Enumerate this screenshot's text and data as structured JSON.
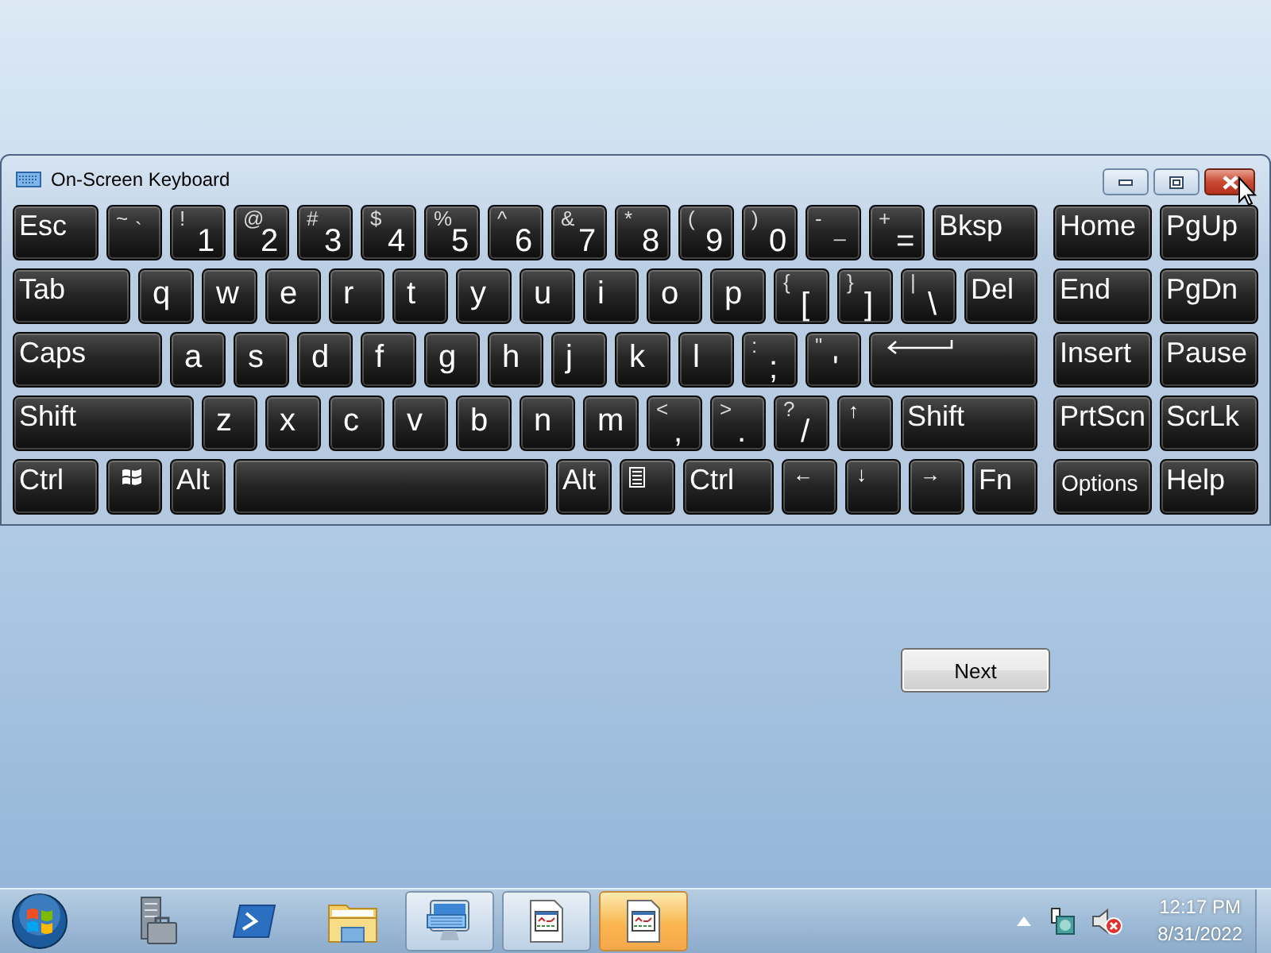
{
  "window": {
    "title": "On-Screen Keyboard"
  },
  "rows": [
    {
      "keys": [
        {
          "kind": "text",
          "label": "Esc"
        },
        {
          "kind": "dual",
          "upper": "~",
          "lower": "`"
        },
        {
          "kind": "pair",
          "upper": "!",
          "lower": "1"
        },
        {
          "kind": "pair",
          "upper": "@",
          "lower": "2"
        },
        {
          "kind": "pair",
          "upper": "#",
          "lower": "3"
        },
        {
          "kind": "pair",
          "upper": "$",
          "lower": "4"
        },
        {
          "kind": "pair",
          "upper": "%",
          "lower": "5"
        },
        {
          "kind": "pair",
          "upper": "^",
          "lower": "6"
        },
        {
          "kind": "pair",
          "upper": "&",
          "lower": "7"
        },
        {
          "kind": "pair",
          "upper": "*",
          "lower": "8"
        },
        {
          "kind": "pair",
          "upper": "(",
          "lower": "9"
        },
        {
          "kind": "pair",
          "upper": ")",
          "lower": "0"
        },
        {
          "kind": "dual",
          "upper": "-",
          "lower": "_"
        },
        {
          "kind": "pair",
          "upper": "+",
          "lower": "="
        },
        {
          "kind": "text",
          "label": "Bksp"
        }
      ],
      "nav": [
        {
          "kind": "text",
          "label": "Home"
        },
        {
          "kind": "text",
          "label": "PgUp"
        }
      ]
    },
    {
      "keys": [
        {
          "kind": "text",
          "label": "Tab"
        },
        {
          "kind": "letter",
          "label": "q"
        },
        {
          "kind": "letter",
          "label": "w"
        },
        {
          "kind": "letter",
          "label": "e"
        },
        {
          "kind": "letter",
          "label": "r"
        },
        {
          "kind": "letter",
          "label": "t"
        },
        {
          "kind": "letter",
          "label": "y"
        },
        {
          "kind": "letter",
          "label": "u"
        },
        {
          "kind": "letter",
          "label": "i"
        },
        {
          "kind": "letter",
          "label": "o"
        },
        {
          "kind": "letter",
          "label": "p"
        },
        {
          "kind": "pair",
          "upper": "{",
          "lower": "["
        },
        {
          "kind": "pair",
          "upper": "}",
          "lower": "]"
        },
        {
          "kind": "pair",
          "upper": "|",
          "lower": "\\"
        },
        {
          "kind": "text",
          "label": "Del"
        }
      ],
      "nav": [
        {
          "kind": "text",
          "label": "End"
        },
        {
          "kind": "text",
          "label": "PgDn"
        }
      ]
    },
    {
      "keys": [
        {
          "kind": "text",
          "label": "Caps"
        },
        {
          "kind": "letter",
          "label": "a"
        },
        {
          "kind": "letter",
          "label": "s"
        },
        {
          "kind": "letter",
          "label": "d"
        },
        {
          "kind": "letter",
          "label": "f"
        },
        {
          "kind": "letter",
          "label": "g"
        },
        {
          "kind": "letter",
          "label": "h"
        },
        {
          "kind": "letter",
          "label": "j"
        },
        {
          "kind": "letter",
          "label": "k"
        },
        {
          "kind": "letter",
          "label": "l"
        },
        {
          "kind": "pair",
          "upper": ":",
          "lower": ";"
        },
        {
          "kind": "pair",
          "upper": "\"",
          "lower": "'"
        },
        {
          "kind": "enter"
        }
      ],
      "nav": [
        {
          "kind": "text",
          "label": "Insert"
        },
        {
          "kind": "text",
          "label": "Pause"
        }
      ]
    },
    {
      "keys": [
        {
          "kind": "text",
          "label": "Shift"
        },
        {
          "kind": "letter",
          "label": "z"
        },
        {
          "kind": "letter",
          "label": "x"
        },
        {
          "kind": "letter",
          "label": "c"
        },
        {
          "kind": "letter",
          "label": "v"
        },
        {
          "kind": "letter",
          "label": "b"
        },
        {
          "kind": "letter",
          "label": "n"
        },
        {
          "kind": "letter",
          "label": "m"
        },
        {
          "kind": "pair",
          "upper": "<",
          "lower": ","
        },
        {
          "kind": "pair",
          "upper": ">",
          "lower": "."
        },
        {
          "kind": "pair",
          "upper": "?",
          "lower": "/"
        },
        {
          "kind": "arrow",
          "label": "↑"
        },
        {
          "kind": "text",
          "label": "Shift"
        }
      ],
      "nav": [
        {
          "kind": "text",
          "label": "PrtScn"
        },
        {
          "kind": "text",
          "label": "ScrLk"
        }
      ]
    },
    {
      "keys": [
        {
          "kind": "text",
          "label": "Ctrl"
        },
        {
          "kind": "windows"
        },
        {
          "kind": "text",
          "label": "Alt"
        },
        {
          "kind": "space"
        },
        {
          "kind": "text",
          "label": "Alt"
        },
        {
          "kind": "menu"
        },
        {
          "kind": "text",
          "label": "Ctrl"
        },
        {
          "kind": "arrow",
          "label": "←"
        },
        {
          "kind": "arrow",
          "label": "↓"
        },
        {
          "kind": "arrow",
          "label": "→"
        },
        {
          "kind": "text",
          "label": "Fn"
        }
      ],
      "nav": [
        {
          "kind": "small",
          "label": "Options"
        },
        {
          "kind": "text",
          "label": "Help"
        }
      ]
    }
  ],
  "next_button": {
    "label": "Next"
  },
  "taskbar": {
    "windows": [
      {
        "kind": "keyboard",
        "highlighted": false
      },
      {
        "kind": "document",
        "highlighted": false
      },
      {
        "kind": "document",
        "highlighted": true
      }
    ],
    "clock": {
      "time": "12:17 PM",
      "date": "8/31/2022"
    }
  }
}
